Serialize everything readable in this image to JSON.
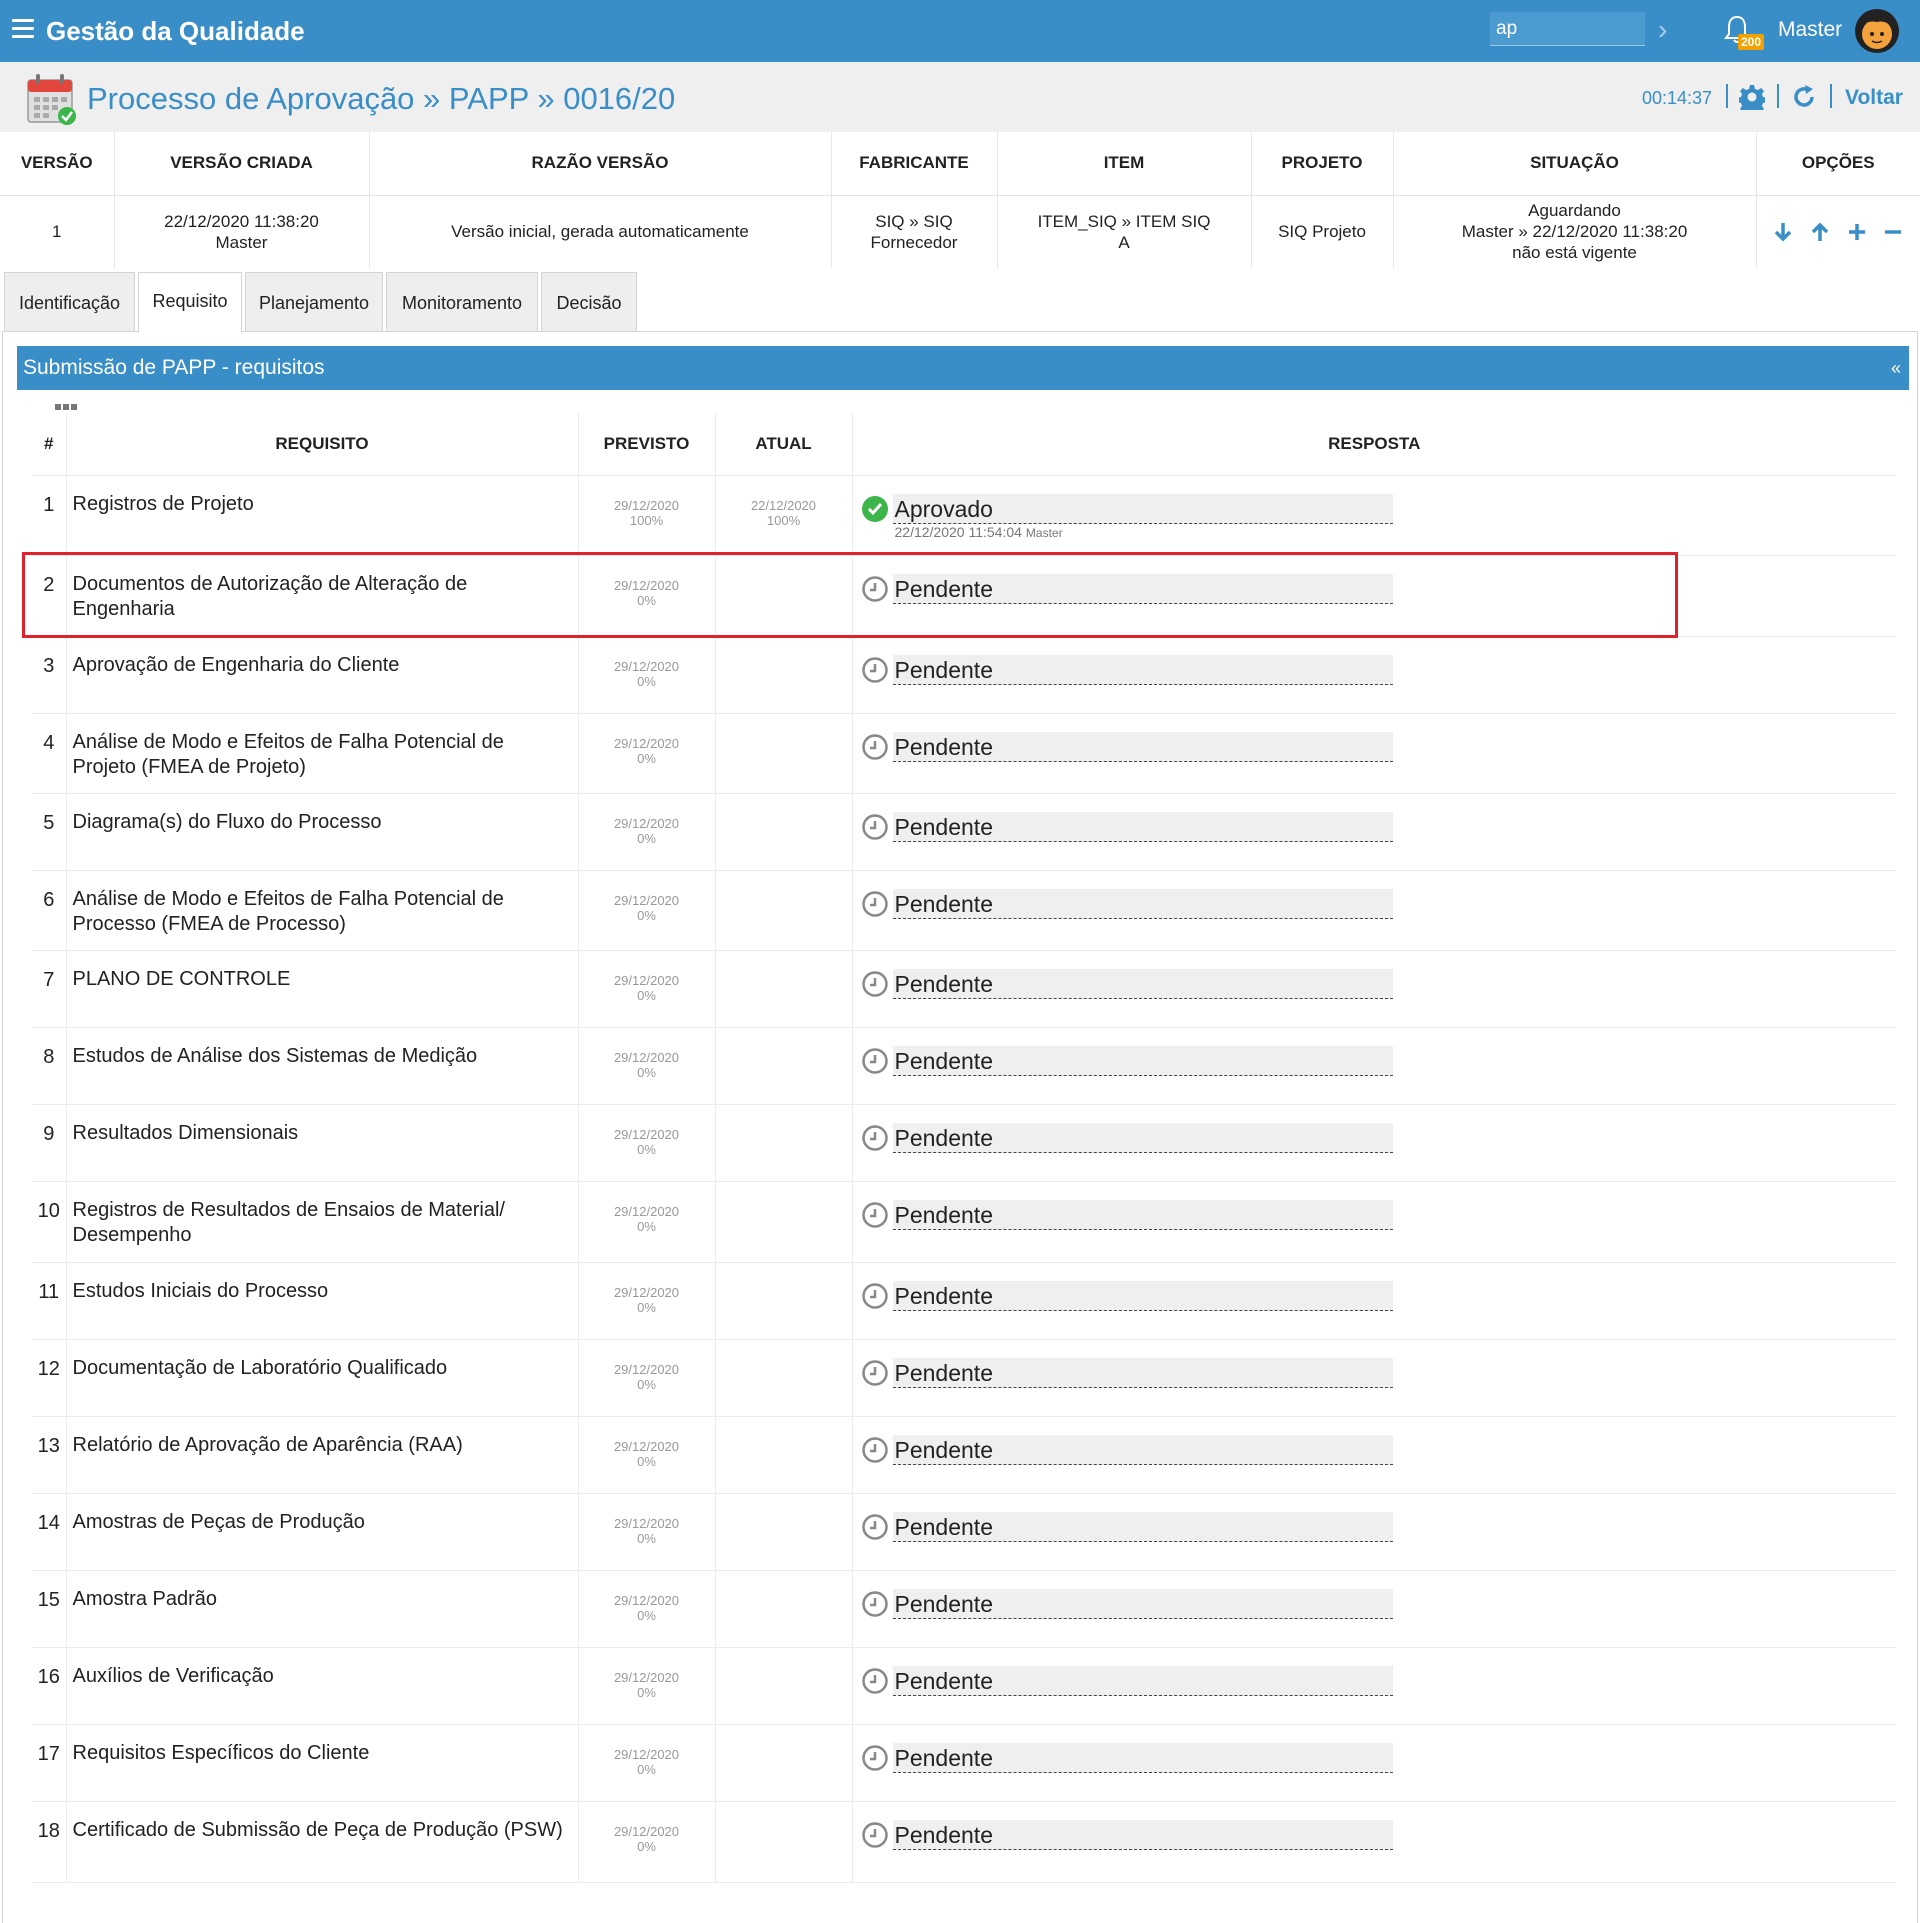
{
  "app": {
    "title": "Gestão da Qualidade",
    "search_value": "ap",
    "notification_count": "200",
    "user": "Master"
  },
  "header": {
    "title": "Processo de Aprovação » PAPP » 0016/20",
    "timer": "00:14:37",
    "back_label": "Voltar"
  },
  "version_table": {
    "headers": [
      "VERSÃO",
      "VERSÃO CRIADA",
      "RAZÃO VERSÃO",
      "FABRICANTE",
      "ITEM",
      "PROJETO",
      "SITUAÇÃO",
      "OPÇÕES"
    ],
    "row": {
      "versao": "1",
      "criada_date": "22/12/2020 11:38:20",
      "criada_user": "Master",
      "razao": "Versão inicial, gerada automaticamente",
      "fabricante_1": "SIQ » SIQ",
      "fabricante_2": "Fornecedor",
      "item_1": "ITEM_SIQ » ITEM SIQ",
      "item_2": "A",
      "projeto": "SIQ Projeto",
      "situacao_1": "Aguardando",
      "situacao_2": "Master » 22/12/2020 11:38:20",
      "situacao_3": "não está vigente"
    }
  },
  "tabs": [
    "Identificação",
    "Requisito",
    "Planejamento",
    "Monitoramento",
    "Decisão"
  ],
  "active_tab": "Requisito",
  "panel": {
    "title": "Submissão de PAPP - requisitos",
    "collapse": "«"
  },
  "req_table": {
    "headers": [
      "#",
      "REQUISITO",
      "PREVISTO",
      "ATUAL",
      "RESPOSTA"
    ],
    "rows": [
      {
        "n": "1",
        "req": "Registros de Projeto",
        "prev_date": "29/12/2020",
        "prev_pct": "100%",
        "atual_date": "22/12/2020",
        "atual_pct": "100%",
        "status": "Aprovado",
        "meta_date": "22/12/2020 11:54:04",
        "meta_user": "Master"
      },
      {
        "n": "2",
        "req": "Documentos de Autorização de Alteração de Engenharia",
        "prev_date": "29/12/2020",
        "prev_pct": "0%",
        "status": "Pendente"
      },
      {
        "n": "3",
        "req": "Aprovação de Engenharia do Cliente",
        "prev_date": "29/12/2020",
        "prev_pct": "0%",
        "status": "Pendente"
      },
      {
        "n": "4",
        "req": "Análise de Modo e Efeitos de Falha Potencial de Projeto (FMEA de Projeto)",
        "prev_date": "29/12/2020",
        "prev_pct": "0%",
        "status": "Pendente"
      },
      {
        "n": "5",
        "req": "Diagrama(s) do Fluxo do Processo",
        "prev_date": "29/12/2020",
        "prev_pct": "0%",
        "status": "Pendente"
      },
      {
        "n": "6",
        "req": "Análise de Modo e Efeitos de Falha Potencial de Processo (FMEA de Processo)",
        "prev_date": "29/12/2020",
        "prev_pct": "0%",
        "status": "Pendente"
      },
      {
        "n": "7",
        "req": "PLANO DE CONTROLE",
        "prev_date": "29/12/2020",
        "prev_pct": "0%",
        "status": "Pendente"
      },
      {
        "n": "8",
        "req": "Estudos de Análise dos Sistemas de Medição",
        "prev_date": "29/12/2020",
        "prev_pct": "0%",
        "status": "Pendente"
      },
      {
        "n": "9",
        "req": "Resultados Dimensionais",
        "prev_date": "29/12/2020",
        "prev_pct": "0%",
        "status": "Pendente"
      },
      {
        "n": "10",
        "req": "Registros de Resultados de Ensaios de Material/ Desempenho",
        "prev_date": "29/12/2020",
        "prev_pct": "0%",
        "status": "Pendente"
      },
      {
        "n": "11",
        "req": "Estudos Iniciais do Processo",
        "prev_date": "29/12/2020",
        "prev_pct": "0%",
        "status": "Pendente"
      },
      {
        "n": "12",
        "req": "Documentação de Laboratório Qualificado",
        "prev_date": "29/12/2020",
        "prev_pct": "0%",
        "status": "Pendente"
      },
      {
        "n": "13",
        "req": "Relatório de Aprovação de Aparência (RAA)",
        "prev_date": "29/12/2020",
        "prev_pct": "0%",
        "status": "Pendente"
      },
      {
        "n": "14",
        "req": "Amostras de Peças de Produção",
        "prev_date": "29/12/2020",
        "prev_pct": "0%",
        "status": "Pendente"
      },
      {
        "n": "15",
        "req": "Amostra Padrão",
        "prev_date": "29/12/2020",
        "prev_pct": "0%",
        "status": "Pendente"
      },
      {
        "n": "16",
        "req": "Auxílios de Verificação",
        "prev_date": "29/12/2020",
        "prev_pct": "0%",
        "status": "Pendente"
      },
      {
        "n": "17",
        "req": "Requisitos Específicos do Cliente",
        "prev_date": "29/12/2020",
        "prev_pct": "0%",
        "status": "Pendente"
      },
      {
        "n": "18",
        "req": "Certificado de Submissão de Peça de Produção (PSW)",
        "prev_date": "29/12/2020",
        "prev_pct": "0%",
        "status": "Pendente"
      }
    ]
  },
  "colors": {
    "brand": "#3a8ec7",
    "approved": "#3cb54a",
    "highlight": "#e0202a"
  }
}
